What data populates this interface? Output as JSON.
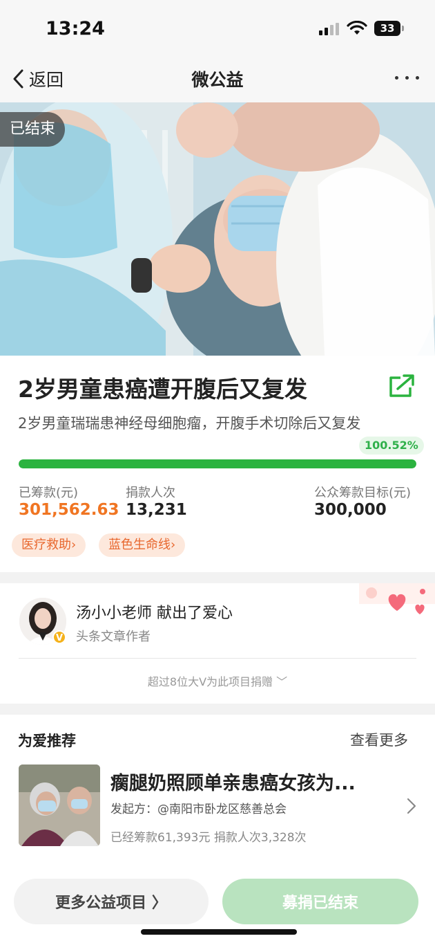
{
  "status_bar": {
    "time": "13:24",
    "battery": "33",
    "icons": [
      "signal-icon",
      "wifi-icon",
      "battery-icon"
    ]
  },
  "nav": {
    "back_label": "返回",
    "title": "微公益",
    "more_icon": "more-dots-icon"
  },
  "hero": {
    "status_tag": "已结束"
  },
  "project": {
    "title": "2岁男童患癌遭开腹后又复发",
    "subtitle": "2岁男童瑞瑞患神经母细胞瘤，开腹手术切除后又复发",
    "progress_label": "100.52%",
    "progress_fraction": 1.0,
    "raised_label": "已筹款(元)",
    "raised_value": "301,562.63",
    "donors_label": "捐款人次",
    "donors_value": "13,231",
    "goal_label": "公众筹款目标(元)",
    "goal_value": "300,000",
    "tags": [
      "医疗救助›",
      "蓝色生命线›"
    ]
  },
  "donor": {
    "line": "汤小小老师 献出了爱心",
    "role": "头条文章作者",
    "badge": "V",
    "more_donors": "超过8位大V为此项目捐赠 ﹀"
  },
  "recommend": {
    "heading": "为爱推荐",
    "more_label": "查看更多",
    "items": [
      {
        "title": "瘸腿奶照顾单亲患癌女孩为...",
        "org": "发起方：@南阳市卧龙区慈善总会",
        "stats": "已经筹款61,393元 捐款人次3,328次"
      }
    ]
  },
  "bottom": {
    "more_projects": "更多公益项目 〉",
    "ended": "募捐已结束"
  },
  "colors": {
    "accent_orange": "#f07522",
    "progress_green": "#2bb33f",
    "ended_button": "#b9e3bf",
    "tag_bg": "#fde8dc"
  }
}
